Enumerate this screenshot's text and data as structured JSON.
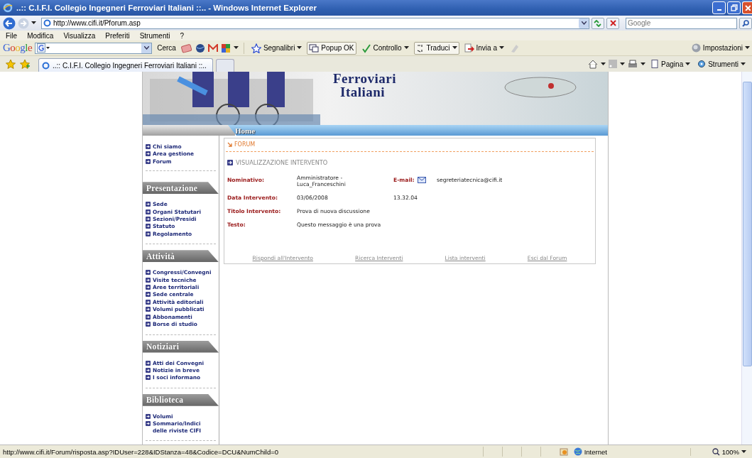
{
  "window": {
    "title": "..:: C.I.F.I. Collegio Ingegneri Ferroviari Italiani ::.. - Windows Internet Explorer"
  },
  "address_bar": {
    "url": "http://www.cifi.it/Pforum.asp"
  },
  "search": {
    "placeholder": "Google"
  },
  "menu_bar": [
    "File",
    "Modifica",
    "Visualizza",
    "Preferiti",
    "Strumenti",
    "?"
  ],
  "google_toolbar": {
    "logo": "Google",
    "search_button": "Cerca",
    "items": [
      {
        "kind": "menu",
        "label": "Segnalibri"
      },
      {
        "kind": "button",
        "label": "Popup OK"
      },
      {
        "kind": "menu",
        "label": "Controllo"
      },
      {
        "kind": "split",
        "label": "Traduci"
      },
      {
        "kind": "menu",
        "label": "Invia a"
      }
    ],
    "settings": "Impostazioni"
  },
  "tabs": [
    {
      "label": "..:: C.I.F.I. Collegio Ingegneri Ferroviari Italiani ::..",
      "selected": true
    }
  ],
  "command_bar": [
    "Pagina",
    "Strumenti"
  ],
  "page": {
    "banner": [
      "Ferroviari",
      "Italiani"
    ],
    "nav": "Home",
    "sidebar": {
      "top_links": [
        "Chi siamo",
        "Area gestione",
        "Forum"
      ],
      "sections": [
        {
          "title": "Presentazione",
          "links": [
            "Sede",
            "Organi Statutari",
            "Sezioni/Presidi",
            "Statuto",
            "Regolamento"
          ]
        },
        {
          "title": "Attività",
          "links": [
            "Congressi/Convegni",
            "Visite tecniche",
            "Aree territoriali",
            "Sede centrale",
            "Attività editoriali",
            "Volumi pubblicati",
            "Abbonamenti",
            "Borse di studio"
          ]
        },
        {
          "title": "Notiziari",
          "links": [
            "Atti dei Convegni",
            "Notizie in breve",
            "I soci informano"
          ]
        },
        {
          "title": "Biblioteca",
          "links": [
            "Volumi",
            "Sommario/Indici delle riviste CIFI"
          ]
        }
      ]
    },
    "forum": {
      "header": "FORUM",
      "subtitle": "VISUALIZZAZIONE INTERVENTO",
      "fields": [
        {
          "label": "Nominativo:",
          "value": "Amministratore - Luca_Franceschini",
          "email_label": "E-mail:",
          "email": "segreteriatecnica@cifi.it"
        },
        {
          "label": "Data Intervento:",
          "value": "03/06/2008",
          "time": "13.32.04"
        },
        {
          "label": "Titolo Intervento:",
          "value": "Prova di nuova discussione"
        },
        {
          "label": "Testo:",
          "value": "Questo messaggio è una prova"
        }
      ],
      "links": [
        "Rispondi all'Intervento",
        "Ricerca Interventi",
        "Lista interventi",
        "Esci dal Forum"
      ]
    }
  },
  "status_bar": {
    "url": "http://www.cifi.it/Forum/risposta.asp?IDUser=228&IDStanza=48&Codice=DCU&NumChild=0",
    "zone": "Internet",
    "zoom": "100%"
  }
}
